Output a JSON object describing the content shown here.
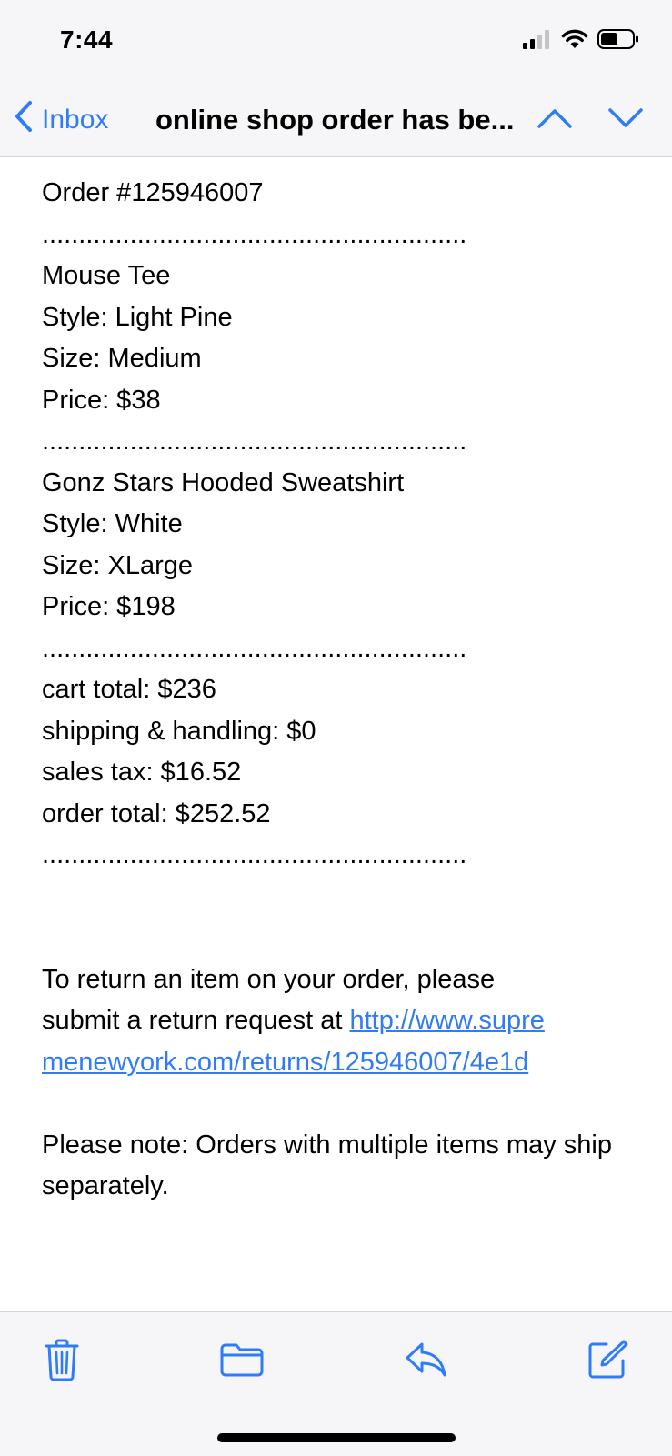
{
  "status_bar": {
    "time": "7:44"
  },
  "nav": {
    "back_label": "Inbox",
    "title": "online shop order has be..."
  },
  "email": {
    "order_number": "Order #125946007",
    "separator": "..........................................................",
    "items": [
      {
        "name": "Mouse Tee",
        "style": "Style: Light Pine",
        "size": "Size: Medium",
        "price": "Price: $38"
      },
      {
        "name": "Gonz Stars Hooded Sweatshirt",
        "style": "Style: White",
        "size": "Size: XLarge",
        "price": "Price: $198"
      }
    ],
    "totals": {
      "cart_total": "cart total: $236",
      "shipping": "shipping & handling: $0",
      "sales_tax": "sales tax: $16.52",
      "order_total": "order total: $252.52"
    },
    "return_text": "To return an item on your order, please submit a return request at ",
    "return_link": "http://www.supremenewyork.com/returns/125946007/4e1d",
    "note": "Please note: Orders with multiple items may ship separately."
  },
  "colors": {
    "accent": "#2f7cf6",
    "bar_background": "#f6f6f8"
  },
  "icons": {
    "back": "chevron-left-icon",
    "previous": "chevron-up-icon",
    "next": "chevron-down-icon",
    "trash": "trash-icon",
    "folder": "folder-icon",
    "reply": "reply-icon",
    "compose": "compose-icon"
  }
}
